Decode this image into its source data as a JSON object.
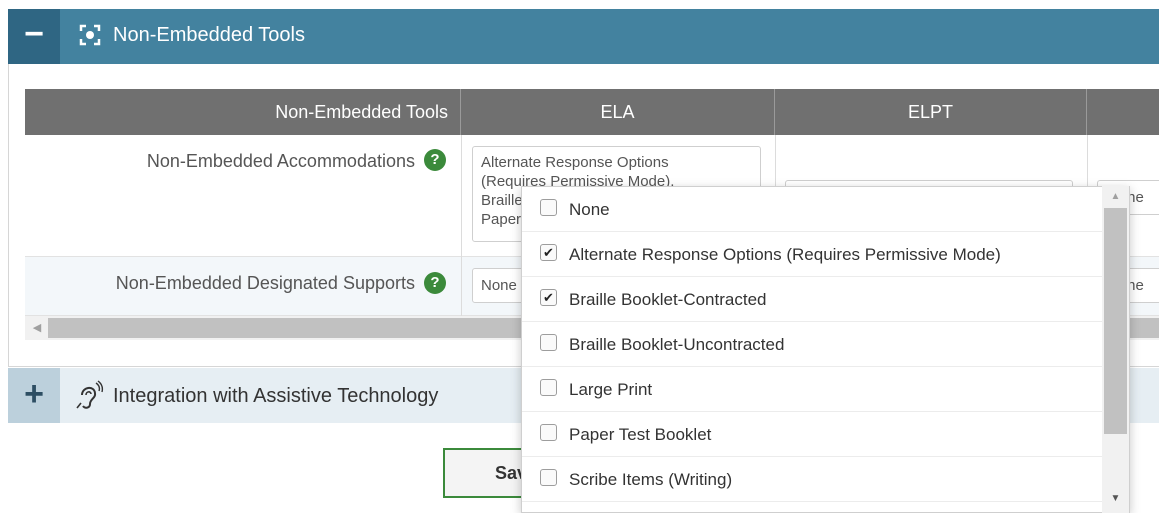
{
  "colors": {
    "header": "#43829f",
    "header_toggle": "#2f6683",
    "table_header": "#707070",
    "check_green": "#3b8a3b"
  },
  "non_embedded_section": {
    "toggle_symbol": "−",
    "icon": "target-icon",
    "title": "Non-Embedded Tools"
  },
  "table": {
    "headers": [
      "Non-Embedded Tools",
      "ELA",
      "ELPT"
    ],
    "rows": [
      {
        "label": "Non-Embedded Accommodations",
        "help": "?",
        "ela_values": [
          "Alternate Response Options",
          "(Requires Permissive Mode),",
          "Braille",
          "Paper"
        ],
        "more_value": "None"
      },
      {
        "label": "Non-Embedded Designated Supports",
        "help": "?",
        "ela_value": "None",
        "more_value": "None"
      }
    ]
  },
  "assistive_section": {
    "toggle_symbol": "+",
    "icon": "hearing-icon",
    "title": "Integration with Assistive Technology"
  },
  "save_button": {
    "label": "Save"
  },
  "dropdown": {
    "options": [
      {
        "label": "None",
        "checked": false
      },
      {
        "label": "Alternate Response Options (Requires Permissive Mode)",
        "checked": true
      },
      {
        "label": "Braille Booklet-Contracted",
        "checked": true
      },
      {
        "label": "Braille Booklet-Uncontracted",
        "checked": false
      },
      {
        "label": "Large Print",
        "checked": false
      },
      {
        "label": "Paper Test Booklet",
        "checked": false
      },
      {
        "label": "Scribe Items (Writing)",
        "checked": false
      }
    ]
  }
}
